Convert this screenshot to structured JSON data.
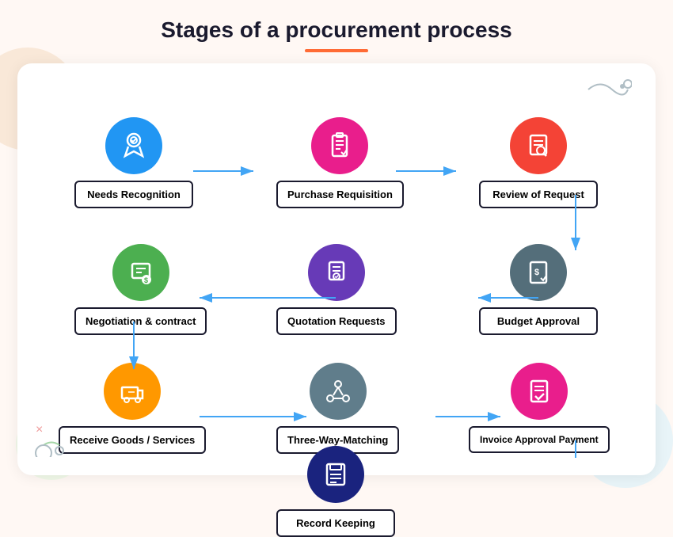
{
  "page": {
    "title": "Stages of a procurement process",
    "title_underline_color": "#ff6b35"
  },
  "stages": [
    {
      "id": "needs-recognition",
      "label": "Needs Recognition",
      "icon": "🏅",
      "icon_unicode": "medal",
      "color": "#2196f3",
      "col": 0,
      "row": 0
    },
    {
      "id": "purchase-requisition",
      "label": "Purchase Requisition",
      "icon": "📋",
      "icon_unicode": "clipboard",
      "color": "#e91e8c",
      "col": 1,
      "row": 0
    },
    {
      "id": "review-of-request",
      "label": "Review of Request",
      "icon": "🔍",
      "icon_unicode": "magnify",
      "color": "#f44336",
      "col": 2,
      "row": 0
    },
    {
      "id": "budget-approval",
      "label": "Budget Approval",
      "icon": "💰",
      "icon_unicode": "money",
      "color": "#546e7a",
      "col": 2,
      "row": 1
    },
    {
      "id": "quotation-requests",
      "label": "Quotation Requests",
      "icon": "📄",
      "icon_unicode": "document",
      "color": "#673ab7",
      "col": 1,
      "row": 1
    },
    {
      "id": "negotiation-contract",
      "label": "Negotiation & contract",
      "icon": "💵",
      "icon_unicode": "contract",
      "color": "#4caf50",
      "col": 0,
      "row": 1
    },
    {
      "id": "receive-goods",
      "label": "Receive Goods / Services",
      "icon": "🚚",
      "icon_unicode": "truck",
      "color": "#ff9800",
      "col": 0,
      "row": 2
    },
    {
      "id": "three-way-matching",
      "label": "Three-Way-Matching",
      "icon": "🔗",
      "icon_unicode": "network",
      "color": "#607d8b",
      "col": 1,
      "row": 2
    },
    {
      "id": "invoice-approval",
      "label": "Invoice Approval Payment",
      "icon": "✅",
      "icon_unicode": "check",
      "color": "#e91e8c",
      "col": 2,
      "row": 2
    },
    {
      "id": "record-keeping",
      "label": "Record Keeping",
      "icon": "📁",
      "icon_unicode": "folder",
      "color": "#1a237e",
      "col": 1,
      "row": 3
    }
  ],
  "arrow_color": "#42a5f5"
}
